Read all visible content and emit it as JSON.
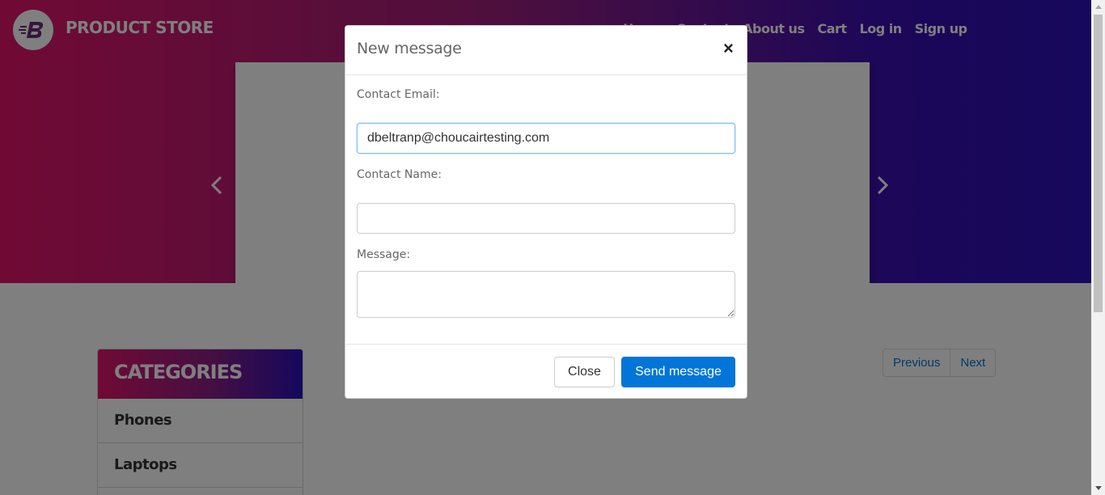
{
  "header": {
    "brand": "PRODUCT STORE",
    "nav": [
      "Home",
      "Contact",
      "About us",
      "Cart",
      "Log in",
      "Sign up"
    ]
  },
  "sidebar": {
    "title": "CATEGORIES",
    "items": [
      "Phones",
      "Laptops"
    ]
  },
  "pagination": {
    "previous": "Previous",
    "next": "Next"
  },
  "modal": {
    "title": "New message",
    "close_symbol": "×",
    "email_label": "Contact Email:",
    "email_value": "dbeltranp@choucairtesting.com",
    "name_label": "Contact Name:",
    "name_value": "",
    "message_label": "Message:",
    "message_value": "",
    "close_button": "Close",
    "send_button": "Send message"
  },
  "colors": {
    "primary": "#0275d8",
    "gradient_start": "#e0156a",
    "gradient_end": "#2c10b8"
  }
}
